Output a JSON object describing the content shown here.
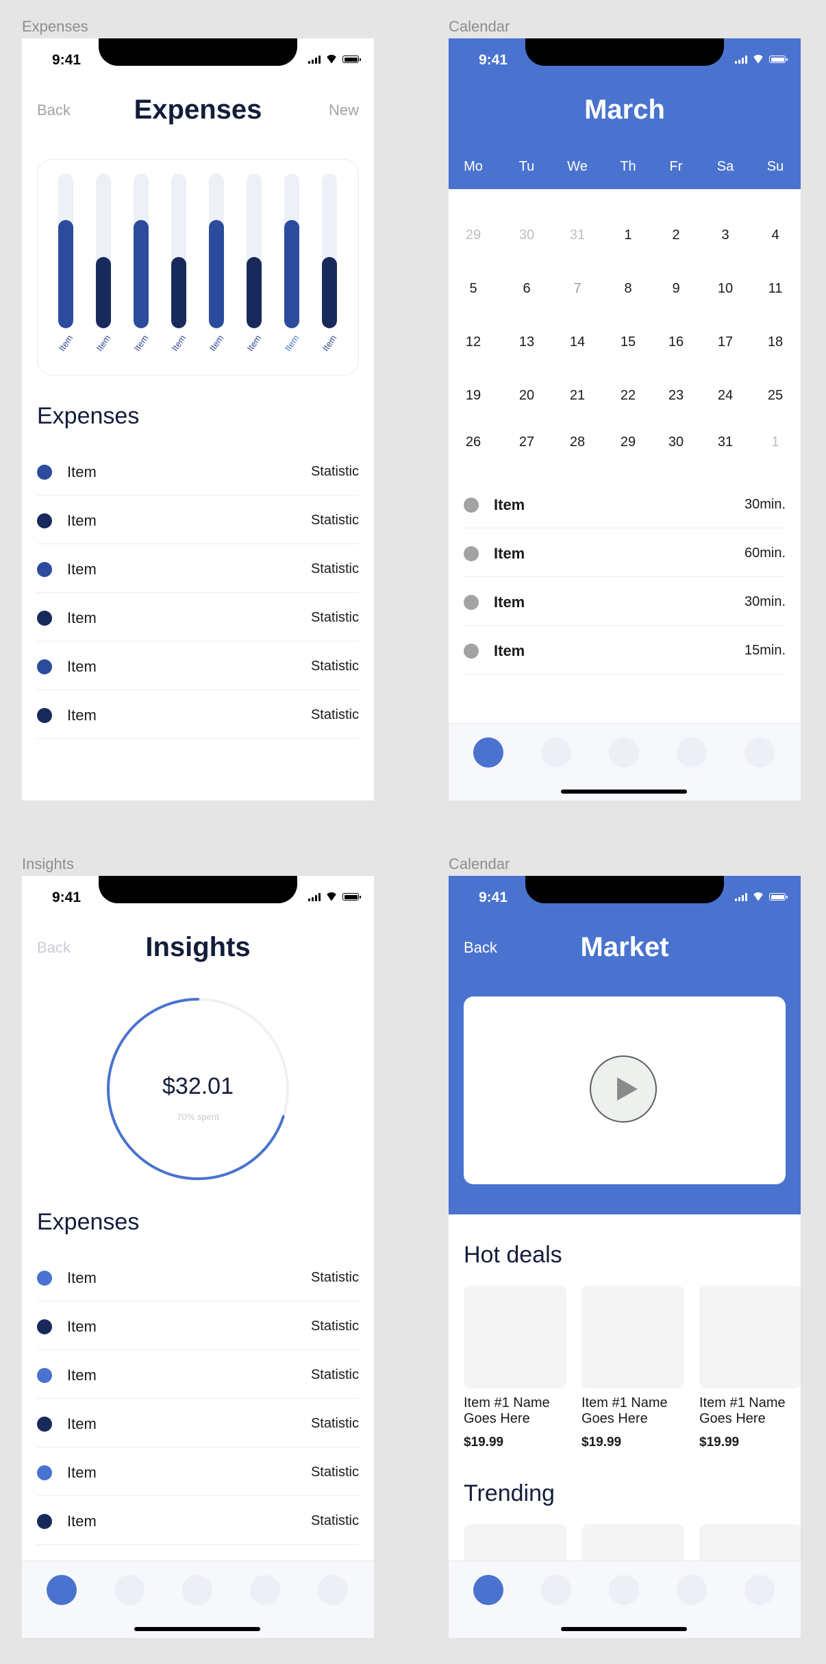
{
  "frames": {
    "expenses_label": "Expenses",
    "calendar_label": "Calendar",
    "insights_label": "Insights",
    "market_label": "Calendar"
  },
  "status_time": "9:41",
  "expenses": {
    "back": "Back",
    "title": "Expenses",
    "new": "New",
    "chart_data": {
      "type": "bar",
      "categories": [
        "Item",
        "Item",
        "Item",
        "Item",
        "Item",
        "Item",
        "Item",
        "Item"
      ],
      "values": [
        0.7,
        0.46,
        0.7,
        0.46,
        0.7,
        0.46,
        0.7,
        0.46
      ],
      "ylim": [
        0,
        1
      ],
      "colors": [
        "#2c4b9c",
        "#182a5c",
        "#2c4b9c",
        "#182a5c",
        "#2c4b9c",
        "#182a5c",
        "#2c4b9c",
        "#182a5c"
      ],
      "highlighted_label_index": 6,
      "highlight_label_color": "#4a73cf"
    },
    "section_title": "Expenses",
    "items": [
      {
        "name": "Item",
        "stat": "Statistic",
        "color": "#2c4b9c"
      },
      {
        "name": "Item",
        "stat": "Statistic",
        "color": "#182a5c"
      },
      {
        "name": "Item",
        "stat": "Statistic",
        "color": "#2c4b9c"
      },
      {
        "name": "Item",
        "stat": "Statistic",
        "color": "#182a5c"
      },
      {
        "name": "Item",
        "stat": "Statistic",
        "color": "#2c4b9c"
      },
      {
        "name": "Item",
        "stat": "Statistic",
        "color": "#182a5c"
      }
    ]
  },
  "calendar": {
    "month": "March",
    "weekdays": [
      "Mo",
      "Tu",
      "We",
      "Th",
      "Fr",
      "Sa",
      "Su"
    ],
    "weeks": [
      [
        {
          "d": "29",
          "s": "muted"
        },
        {
          "d": "30",
          "s": "muted"
        },
        {
          "d": "31",
          "s": "muted"
        },
        {
          "d": "1"
        },
        {
          "d": "2"
        },
        {
          "d": "3"
        },
        {
          "d": "4"
        }
      ],
      [
        {
          "d": "5"
        },
        {
          "d": "6"
        },
        {
          "d": "7",
          "s": "mid"
        },
        {
          "d": "8"
        },
        {
          "d": "9"
        },
        {
          "d": "10"
        },
        {
          "d": "11"
        }
      ],
      [
        {
          "d": "12"
        },
        {
          "d": "13"
        },
        {
          "d": "14"
        },
        {
          "d": "15"
        },
        {
          "d": "16"
        },
        {
          "d": "17"
        },
        {
          "d": "18"
        }
      ],
      [
        {
          "d": "19"
        },
        {
          "d": "20"
        },
        {
          "d": "21"
        },
        {
          "d": "22"
        },
        {
          "d": "23"
        },
        {
          "d": "24"
        },
        {
          "d": "25"
        }
      ],
      [
        {
          "d": "26"
        },
        {
          "d": "27"
        },
        {
          "d": "28"
        },
        {
          "d": "29"
        },
        {
          "d": "30"
        },
        {
          "d": "31"
        },
        {
          "d": "1",
          "s": "muted"
        }
      ]
    ],
    "events": [
      {
        "name": "Item",
        "duration": "30min."
      },
      {
        "name": "Item",
        "duration": "60min."
      },
      {
        "name": "Item",
        "duration": "30min."
      },
      {
        "name": "Item",
        "duration": "15min."
      }
    ]
  },
  "insights": {
    "back": "Back",
    "title": "Insights",
    "amount": "$32.01",
    "spent_label": "70% spent",
    "progress_percent": 70,
    "section_title": "Expenses",
    "items": [
      {
        "name": "Item",
        "stat": "Statistic",
        "color": "#4a73cf"
      },
      {
        "name": "Item",
        "stat": "Statistic",
        "color": "#182a5c"
      },
      {
        "name": "Item",
        "stat": "Statistic",
        "color": "#4a73cf"
      },
      {
        "name": "Item",
        "stat": "Statistic",
        "color": "#182a5c"
      },
      {
        "name": "Item",
        "stat": "Statistic",
        "color": "#4a73cf"
      },
      {
        "name": "Item",
        "stat": "Statistic",
        "color": "#182a5c"
      }
    ]
  },
  "market": {
    "back": "Back",
    "title": "Market",
    "hot_deals_title": "Hot deals",
    "products": [
      {
        "name": "Item #1 Name Goes Here",
        "price": "$19.99"
      },
      {
        "name": "Item #1 Name Goes Here",
        "price": "$19.99"
      },
      {
        "name": "Item #1 Name Goes Here",
        "price": "$19.99"
      }
    ],
    "trending_title": "Trending"
  },
  "colors": {
    "accent": "#4a73cf",
    "navy": "#182a5c",
    "title_text": "#131d3b"
  }
}
